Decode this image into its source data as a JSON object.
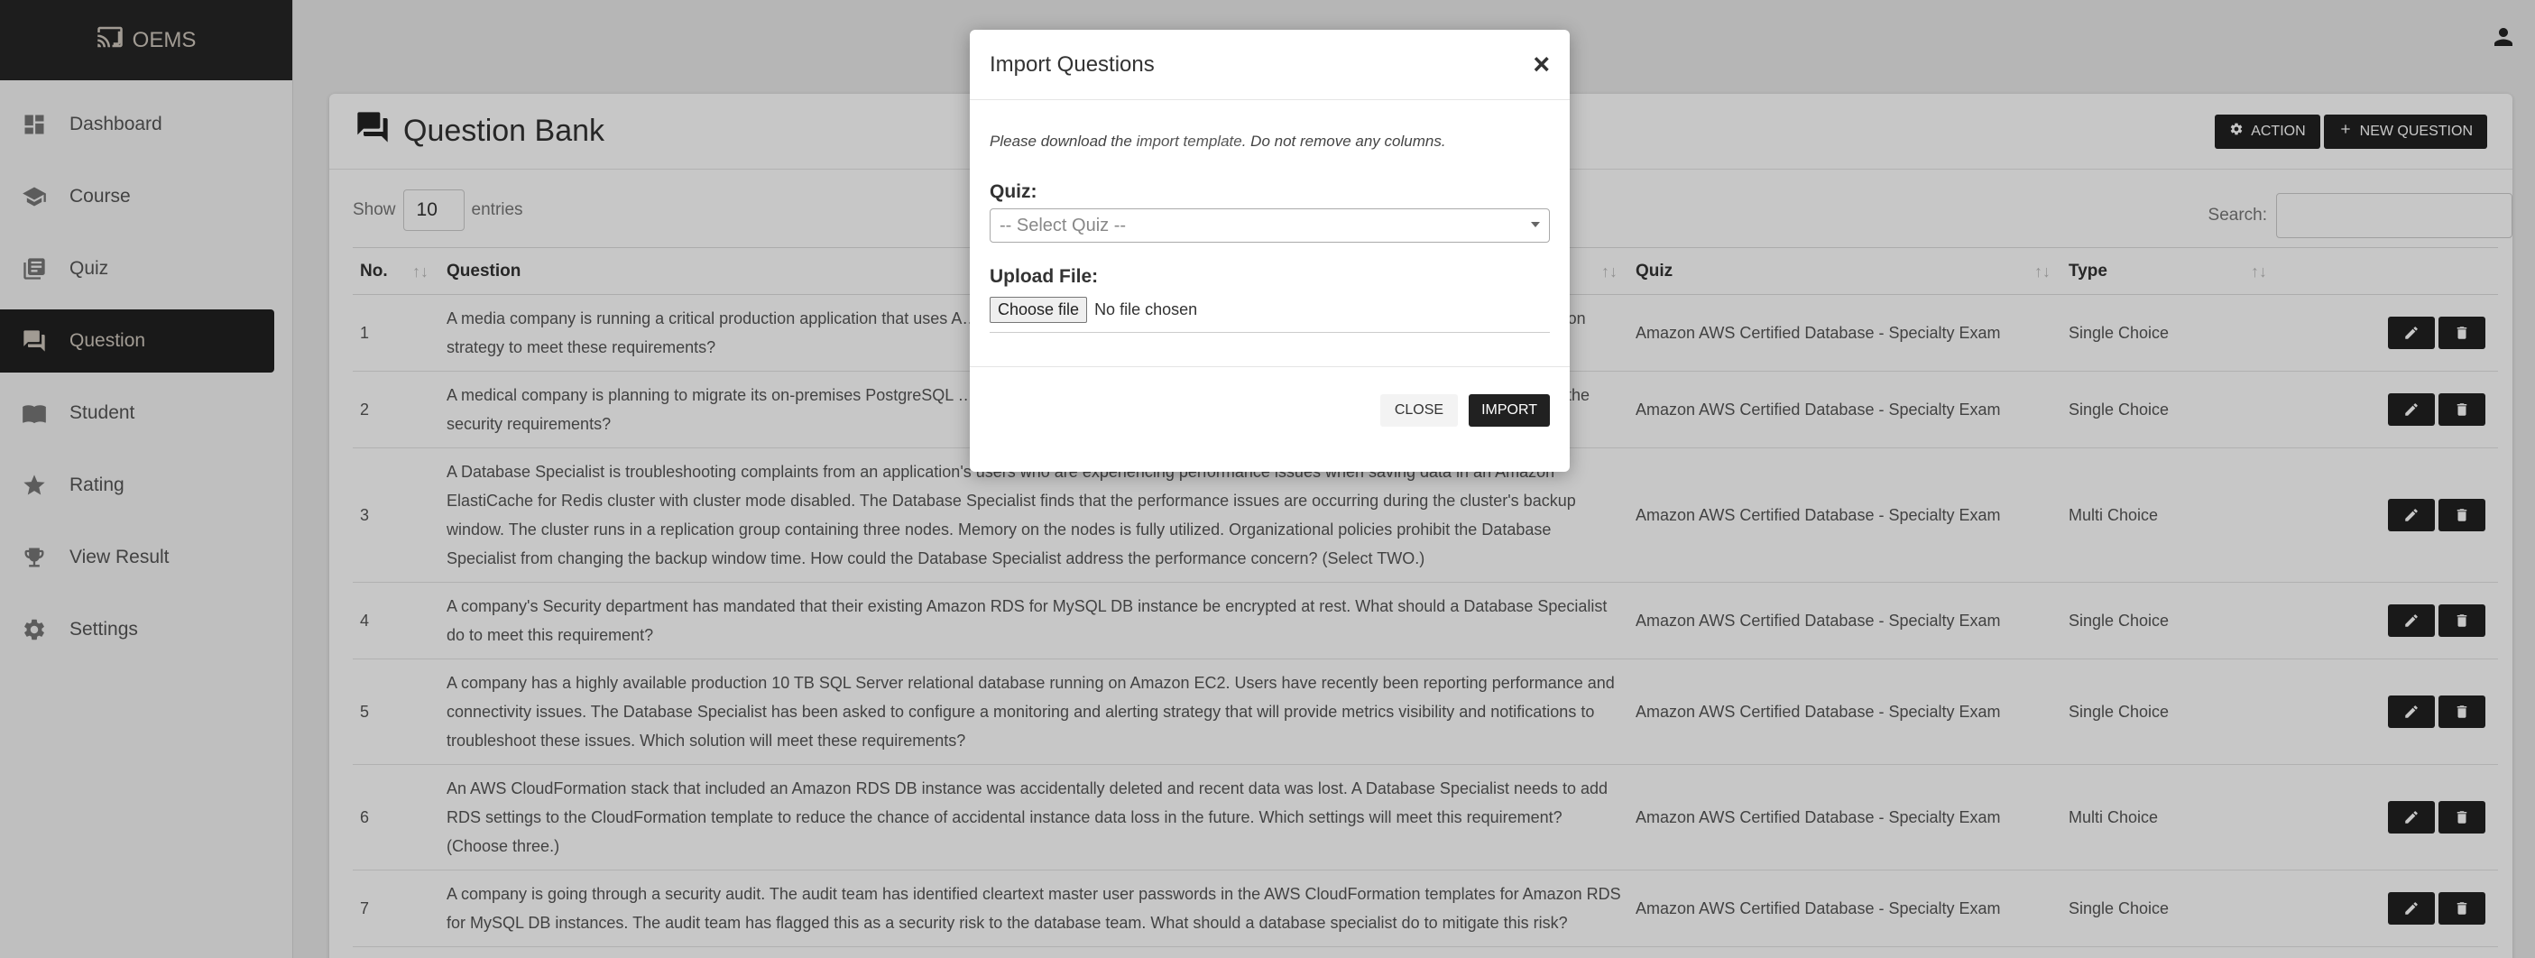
{
  "brand": {
    "name": "OEMS"
  },
  "sidebar": {
    "items": [
      {
        "label": "Dashboard",
        "icon": "dashboard-icon"
      },
      {
        "label": "Course",
        "icon": "graduation-cap-icon"
      },
      {
        "label": "Quiz",
        "icon": "library-books-icon"
      },
      {
        "label": "Question",
        "icon": "forum-icon",
        "active": true
      },
      {
        "label": "Student",
        "icon": "reading-person-icon"
      },
      {
        "label": "Rating",
        "icon": "star-icon"
      },
      {
        "label": "View Result",
        "icon": "trophy-icon"
      },
      {
        "label": "Settings",
        "icon": "gear-icon"
      }
    ]
  },
  "page": {
    "title": "Question Bank",
    "action_label": "ACTION",
    "new_question_label": "NEW QUESTION"
  },
  "table": {
    "show_label": "Show",
    "entries_value": "10",
    "entries_label": "entries",
    "search_label": "Search:",
    "headers": [
      "No.",
      "Question",
      "Quiz",
      "Type"
    ],
    "rows": [
      {
        "no": "1",
        "question": "A media company is running a critical production application that uses A… 25 TB. The IT Director wants to migrate the database to Amazon Aurora… migration strategy to meet these requirements?",
        "quiz": "Amazon AWS Certified Database - Specialty Exam",
        "type": "Single Choice"
      },
      {
        "no": "2",
        "question": "A medical company is planning to migrate its on-premises PostgreSQL … is being considered as the target database engine. Access to the databa… meets the security requirements?",
        "quiz": "Amazon AWS Certified Database - Specialty Exam",
        "type": "Single Choice"
      },
      {
        "no": "3",
        "question": "A Database Specialist is troubleshooting complaints from an application's users who are experiencing performance issues when saving data in an Amazon ElastiCache for Redis cluster with cluster mode disabled. The Database Specialist finds that the performance issues are occurring during the cluster's backup window. The cluster runs in a replication group containing three nodes. Memory on the nodes is fully utilized. Organizational policies prohibit the Database Specialist from changing the backup window time. How could the Database Specialist address the performance concern? (Select TWO.)",
        "quiz": "Amazon AWS Certified Database - Specialty Exam",
        "type": "Multi Choice"
      },
      {
        "no": "4",
        "question": "A company's Security department has mandated that their existing Amazon RDS for MySQL DB instance be encrypted at rest. What should a Database Specialist do to meet this requirement?",
        "quiz": "Amazon AWS Certified Database - Specialty Exam",
        "type": "Single Choice"
      },
      {
        "no": "5",
        "question": "A company has a highly available production 10 TB SQL Server relational database running on Amazon EC2. Users have recently been reporting performance and connectivity issues. The Database Specialist has been asked to configure a monitoring and alerting strategy that will provide metrics visibility and notifications to troubleshoot these issues. Which solution will meet these requirements?",
        "quiz": "Amazon AWS Certified Database - Specialty Exam",
        "type": "Single Choice"
      },
      {
        "no": "6",
        "question": "An AWS CloudFormation stack that included an Amazon RDS DB instance was accidentally deleted and recent data was lost. A Database Specialist needs to add RDS settings to the CloudFormation template to reduce the chance of accidental instance data loss in the future. Which settings will meet this requirement? (Choose three.)",
        "quiz": "Amazon AWS Certified Database - Specialty Exam",
        "type": "Multi Choice"
      },
      {
        "no": "7",
        "question": "A company is going through a security audit. The audit team has identified cleartext master user passwords in the AWS CloudFormation templates for Amazon RDS for MySQL DB instances. The audit team has flagged this as a security risk to the database team. What should a database specialist do to mitigate this risk?",
        "quiz": "Amazon AWS Certified Database - Specialty Exam",
        "type": "Single Choice"
      }
    ]
  },
  "modal": {
    "title": "Import Questions",
    "close_symbol": "×",
    "hint_prefix": "Please download the ",
    "hint_link": "import template",
    "hint_suffix": ". Do not remove any columns.",
    "quiz_label": "Quiz:",
    "quiz_placeholder": "-- Select Quiz --",
    "upload_label": "Upload File:",
    "choose_file_label": "Choose file",
    "no_file_label": "No file chosen",
    "close_label": "CLOSE",
    "import_label": "IMPORT"
  }
}
